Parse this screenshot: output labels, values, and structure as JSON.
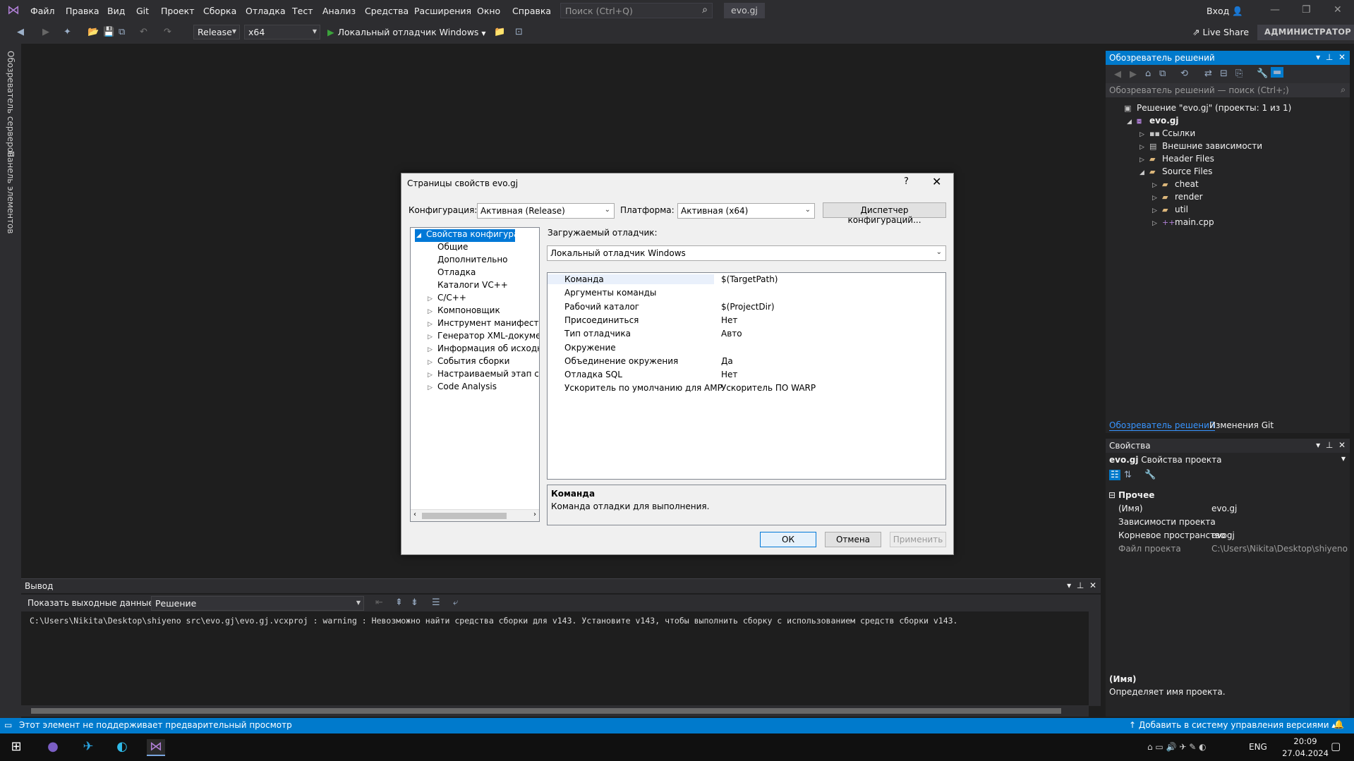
{
  "menubar": {
    "items": [
      "Файл",
      "Правка",
      "Вид",
      "Git",
      "Проект",
      "Сборка",
      "Отладка",
      "Тест",
      "Анализ",
      "Средства",
      "Расширения",
      "Окно",
      "Справка"
    ],
    "search_placeholder": "Поиск (Ctrl+Q)",
    "solution_name": "evo.gj",
    "signin": "Вход"
  },
  "toolbar": {
    "configuration": "Release",
    "platform": "x64",
    "debugger": "Локальный отладчик Windows",
    "liveshare": "Live Share",
    "admin": "АДМИНИСТРАТОР"
  },
  "left_tabs": [
    "Обозреватель серверов",
    "Панель элементов"
  ],
  "solution_explorer": {
    "title": "Обозреватель решений",
    "search_placeholder": "Обозреватель решений — поиск (Ctrl+;)",
    "items": [
      {
        "label": "Решение \"evo.gj\" (проекты: 1 из 1)",
        "depth": 0,
        "exp": "",
        "icon": "solution-icon"
      },
      {
        "label": "evo.gj",
        "depth": 1,
        "exp": "◢",
        "icon": "project-icon",
        "bold": true
      },
      {
        "label": "Ссылки",
        "depth": 2,
        "exp": "▷",
        "icon": "references-icon"
      },
      {
        "label": "Внешние зависимости",
        "depth": 2,
        "exp": "▷",
        "icon": "dependencies-icon"
      },
      {
        "label": "Header Files",
        "depth": 2,
        "exp": "▷",
        "icon": "folder-icon"
      },
      {
        "label": "Source Files",
        "depth": 2,
        "exp": "◢",
        "icon": "folder-icon"
      },
      {
        "label": "cheat",
        "depth": 3,
        "exp": "▷",
        "icon": "folder-icon"
      },
      {
        "label": "render",
        "depth": 3,
        "exp": "▷",
        "icon": "folder-icon"
      },
      {
        "label": "util",
        "depth": 3,
        "exp": "▷",
        "icon": "folder-icon"
      },
      {
        "label": "main.cpp",
        "depth": 3,
        "exp": "▷",
        "icon": "cpp-file-icon"
      }
    ],
    "tab_explorer": "Обозреватель решений",
    "tab_git": "Изменения Git"
  },
  "properties": {
    "title": "Свойства",
    "object": "evo.gj",
    "object_type": "Свойства проекта",
    "category": "Прочее",
    "rows": [
      {
        "k": "(Имя)",
        "v": "evo.gj"
      },
      {
        "k": "Зависимости проекта",
        "v": ""
      },
      {
        "k": "Корневое пространство",
        "v": "evogj"
      },
      {
        "k": "Файл проекта",
        "v": "C:\\Users\\Nikita\\Desktop\\shiyeno src"
      }
    ],
    "desc_title": "(Имя)",
    "desc_text": "Определяет имя проекта."
  },
  "output": {
    "title": "Вывод",
    "show_from_label": "Показать выходные данные из:",
    "source": "Решение",
    "text": "C:\\Users\\Nikita\\Desktop\\shiyeno src\\evo.gj\\evo.gj.vcxproj : warning  : Невозможно найти средства сборки для v143. Установите v143, чтобы выполнить сборку с использованием средств сборки v143."
  },
  "statusbar": {
    "left": "Этот элемент не поддерживает предварительный просмотр",
    "right": "Добавить в систему управления версиями"
  },
  "taskbar": {
    "lang": "ENG",
    "time": "20:09",
    "date": "27.04.2024"
  },
  "dialog": {
    "title": "Страницы свойств evo.gj",
    "help": "?",
    "config_label": "Конфигурация:",
    "config_value": "Активная (Release)",
    "platform_label": "Платформа:",
    "platform_value": "Активная (x64)",
    "config_manager": "Диспетчер конфигураций...",
    "tree": [
      {
        "label": "Свойства конфигурации",
        "depth": 0,
        "exp": "◢",
        "selected": true
      },
      {
        "label": "Общие",
        "depth": 1,
        "exp": ""
      },
      {
        "label": "Дополнительно",
        "depth": 1,
        "exp": ""
      },
      {
        "label": "Отладка",
        "depth": 1,
        "exp": ""
      },
      {
        "label": "Каталоги VC++",
        "depth": 1,
        "exp": ""
      },
      {
        "label": "C/C++",
        "depth": 1,
        "exp": "▷"
      },
      {
        "label": "Компоновщик",
        "depth": 1,
        "exp": "▷"
      },
      {
        "label": "Инструмент манифеста",
        "depth": 1,
        "exp": "▷"
      },
      {
        "label": "Генератор XML-докумен",
        "depth": 1,
        "exp": "▷"
      },
      {
        "label": "Информация об исходно",
        "depth": 1,
        "exp": "▷"
      },
      {
        "label": "События сборки",
        "depth": 1,
        "exp": "▷"
      },
      {
        "label": "Настраиваемый этап сбо",
        "depth": 1,
        "exp": "▷"
      },
      {
        "label": "Code Analysis",
        "depth": 1,
        "exp": "▷"
      }
    ],
    "debugger_label": "Загружаемый отладчик:",
    "debugger_value": "Локальный отладчик Windows",
    "grid": [
      {
        "k": "Команда",
        "v": "$(TargetPath)"
      },
      {
        "k": "Аргументы команды",
        "v": ""
      },
      {
        "k": "Рабочий каталог",
        "v": "$(ProjectDir)"
      },
      {
        "k": "Присоединиться",
        "v": "Нет"
      },
      {
        "k": "Тип отладчика",
        "v": "Авто"
      },
      {
        "k": "Окружение",
        "v": ""
      },
      {
        "k": "Объединение окружения",
        "v": "Да"
      },
      {
        "k": "Отладка SQL",
        "v": "Нет"
      },
      {
        "k": "Ускоритель по умолчанию для AMP",
        "v": "Ускоритель ПО WARP"
      }
    ],
    "desc_title": "Команда",
    "desc_text": "Команда отладки для выполнения.",
    "ok": "ОК",
    "cancel": "Отмена",
    "apply": "Применить"
  }
}
